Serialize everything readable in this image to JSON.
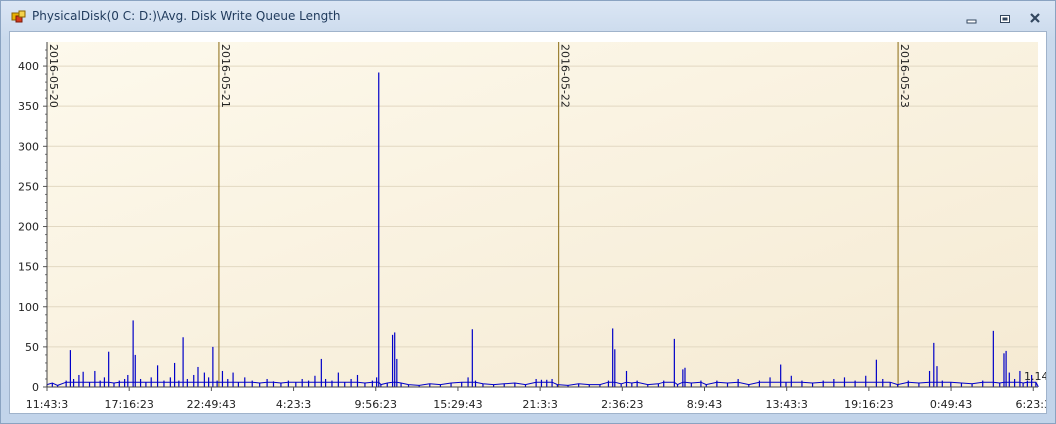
{
  "window": {
    "title": "PhysicalDisk(0 C: D:)\\Avg. Disk Write Queue Length",
    "icons": [
      "app-icon",
      "minimize-icon",
      "restore-icon",
      "close-icon"
    ]
  },
  "colors": {
    "series": "#0000c8",
    "day_marker": "#8b6b14",
    "plot_bg_from": "#fdf9ec",
    "plot_bg_to": "#f5ead3",
    "grid": "#e2d8c2"
  },
  "chart_data": {
    "type": "line",
    "title": "PhysicalDisk(0 C: D:)\\Avg. Disk Write Queue Length",
    "xlabel": "",
    "ylabel": "",
    "ylim": [
      0,
      430
    ],
    "yticks": [
      0,
      50,
      100,
      150,
      200,
      250,
      300,
      350,
      400
    ],
    "grid": true,
    "x_range_hours": [
      0,
      93.2
    ],
    "x_tick_labels": [
      "11:43:3",
      "17:16:23",
      "22:49:43",
      "4:23:3",
      "9:56:23",
      "15:29:43",
      "21:3:3",
      "2:36:23",
      "8:9:43",
      "13:43:3",
      "19:16:23",
      "0:49:43",
      "6:23:3"
    ],
    "x_tick_hours": [
      0,
      5.5556,
      11.1111,
      16.6667,
      22.2222,
      27.7778,
      33.3333,
      38.8889,
      44.4444,
      50.0,
      55.5556,
      61.1111,
      66.6667
    ],
    "x_tick_scale": 1.3913,
    "day_markers": [
      {
        "label": "2016-05-20",
        "hour": 0
      },
      {
        "label": "2016-05-21",
        "hour": 16.17
      },
      {
        "label": "2016-05-22",
        "hour": 48.12
      },
      {
        "label": "2016-05-23",
        "hour": 80.04
      }
    ],
    "end_label": "1.14",
    "series": [
      {
        "points": [
          [
            0.0,
            3
          ],
          [
            0.5,
            5
          ],
          [
            1.0,
            2
          ],
          [
            1.8,
            8
          ],
          [
            2.2,
            46
          ],
          [
            2.5,
            10
          ],
          [
            3.0,
            15
          ],
          [
            3.4,
            19
          ],
          [
            4.0,
            6
          ],
          [
            4.5,
            20
          ],
          [
            5.0,
            8
          ],
          [
            5.4,
            12
          ],
          [
            5.8,
            44
          ],
          [
            6.3,
            5
          ],
          [
            6.8,
            8
          ],
          [
            7.3,
            10
          ],
          [
            7.6,
            15
          ],
          [
            8.1,
            83
          ],
          [
            8.3,
            40
          ],
          [
            8.8,
            10
          ],
          [
            9.3,
            6
          ],
          [
            9.8,
            12
          ],
          [
            10.4,
            27
          ],
          [
            11.0,
            8
          ],
          [
            11.6,
            12
          ],
          [
            12.0,
            30
          ],
          [
            12.4,
            8
          ],
          [
            12.8,
            62
          ],
          [
            13.2,
            10
          ],
          [
            13.8,
            15
          ],
          [
            14.2,
            25
          ],
          [
            14.8,
            18
          ],
          [
            15.2,
            12
          ],
          [
            15.6,
            50
          ],
          [
            16.0,
            8
          ],
          [
            16.5,
            20
          ],
          [
            17.0,
            10
          ],
          [
            17.5,
            18
          ],
          [
            18.0,
            6
          ],
          [
            18.6,
            12
          ],
          [
            19.3,
            8
          ],
          [
            20.0,
            5
          ],
          [
            20.7,
            10
          ],
          [
            21.3,
            7
          ],
          [
            22.0,
            5
          ],
          [
            22.7,
            8
          ],
          [
            23.4,
            6
          ],
          [
            24.0,
            10
          ],
          [
            24.6,
            8
          ],
          [
            25.2,
            14
          ],
          [
            25.8,
            35
          ],
          [
            26.2,
            10
          ],
          [
            26.8,
            8
          ],
          [
            27.4,
            18
          ],
          [
            28.0,
            6
          ],
          [
            28.6,
            10
          ],
          [
            29.2,
            15
          ],
          [
            29.9,
            5
          ],
          [
            30.6,
            8
          ],
          [
            31.0,
            12
          ],
          [
            31.2,
            392
          ],
          [
            31.4,
            3
          ],
          [
            32.0,
            5
          ],
          [
            32.5,
            65
          ],
          [
            32.7,
            68
          ],
          [
            32.9,
            35
          ],
          [
            33.3,
            5
          ],
          [
            34.0,
            3
          ],
          [
            35.0,
            2
          ],
          [
            36.0,
            4
          ],
          [
            37.0,
            3
          ],
          [
            38.0,
            5
          ],
          [
            39.0,
            6
          ],
          [
            39.6,
            12
          ],
          [
            40.0,
            72
          ],
          [
            40.3,
            8
          ],
          [
            41.0,
            4
          ],
          [
            42.0,
            3
          ],
          [
            43.0,
            4
          ],
          [
            44.0,
            5
          ],
          [
            45.0,
            3
          ],
          [
            46.0,
            10
          ],
          [
            46.5,
            9
          ],
          [
            47.0,
            9
          ],
          [
            47.5,
            10
          ],
          [
            48.0,
            3
          ],
          [
            49.0,
            2
          ],
          [
            50.0,
            4
          ],
          [
            51.0,
            3
          ],
          [
            52.0,
            3
          ],
          [
            52.8,
            8
          ],
          [
            53.2,
            73
          ],
          [
            53.4,
            47
          ],
          [
            54.0,
            4
          ],
          [
            54.5,
            20
          ],
          [
            55.0,
            5
          ],
          [
            55.5,
            8
          ],
          [
            56.5,
            3
          ],
          [
            57.5,
            4
          ],
          [
            58.0,
            8
          ],
          [
            59.0,
            60
          ],
          [
            59.3,
            3
          ],
          [
            59.8,
            22
          ],
          [
            60.0,
            24
          ],
          [
            60.6,
            5
          ],
          [
            61.5,
            8
          ],
          [
            62.0,
            3
          ],
          [
            63.0,
            8
          ],
          [
            64.0,
            5
          ],
          [
            65.0,
            10
          ],
          [
            66.0,
            3
          ],
          [
            67.0,
            8
          ],
          [
            68.0,
            12
          ],
          [
            69.0,
            28
          ],
          [
            69.5,
            6
          ],
          [
            70.0,
            14
          ],
          [
            71.0,
            8
          ],
          [
            72.0,
            5
          ],
          [
            73.0,
            8
          ],
          [
            74.0,
            10
          ],
          [
            75.0,
            12
          ],
          [
            76.0,
            8
          ],
          [
            77.0,
            14
          ],
          [
            78.0,
            34
          ],
          [
            78.6,
            10
          ],
          [
            79.3,
            6
          ],
          [
            80.0,
            3
          ],
          [
            81.0,
            8
          ],
          [
            82.0,
            5
          ],
          [
            83.0,
            20
          ],
          [
            83.4,
            55
          ],
          [
            83.7,
            26
          ],
          [
            84.2,
            8
          ],
          [
            85.0,
            6
          ],
          [
            86.0,
            5
          ],
          [
            87.0,
            4
          ],
          [
            88.0,
            8
          ],
          [
            89.0,
            70
          ],
          [
            89.6,
            5
          ],
          [
            90.0,
            42
          ],
          [
            90.2,
            45
          ],
          [
            90.5,
            18
          ],
          [
            91.0,
            10
          ],
          [
            91.5,
            20
          ],
          [
            91.8,
            5
          ],
          [
            92.2,
            8
          ],
          [
            92.6,
            15
          ],
          [
            93.0,
            6
          ],
          [
            93.2,
            1.14
          ]
        ]
      }
    ]
  }
}
